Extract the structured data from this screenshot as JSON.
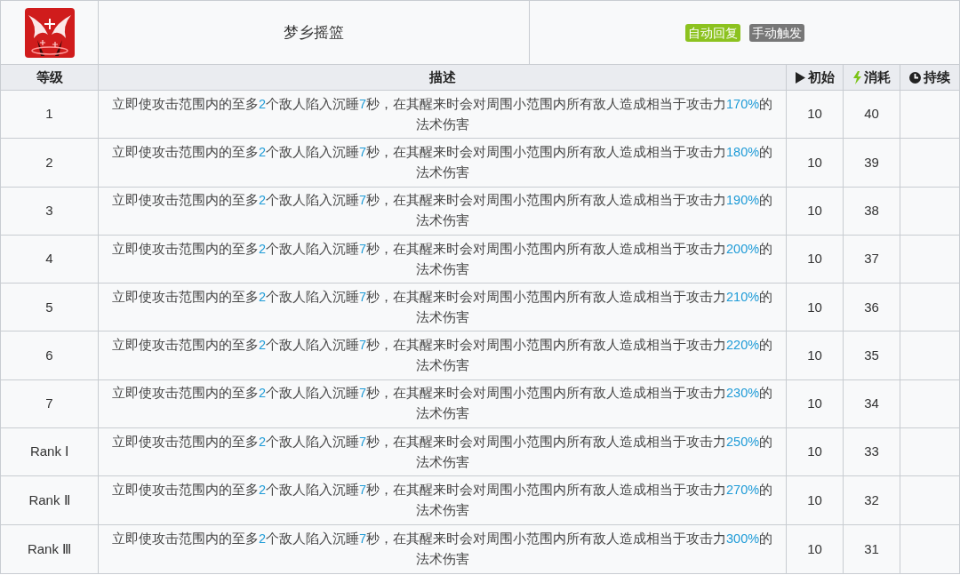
{
  "skill": {
    "name": "梦乡摇篮",
    "tags": [
      {
        "label": "自动回复",
        "color": "#8cc21f"
      },
      {
        "label": "手动触发",
        "color": "#777777"
      }
    ]
  },
  "columns": [
    {
      "label": "等级"
    },
    {
      "label": "描述"
    },
    {
      "label": "初始"
    },
    {
      "label": "消耗"
    },
    {
      "label": "持续"
    }
  ],
  "rows": [
    {
      "level": "1",
      "description": [
        {
          "text": "立即使攻击范围内的至多",
          "highlight": false
        },
        {
          "text": "2",
          "highlight": true
        },
        {
          "text": "个敌人陷入沉睡",
          "highlight": false
        },
        {
          "text": "7",
          "highlight": true
        },
        {
          "text": "秒，在其醒来时会对周围小范围内所有敌人造成相当于攻击力",
          "highlight": false
        },
        {
          "text": "170%",
          "highlight": true
        },
        {
          "text": "的法术伤害",
          "highlight": false
        }
      ],
      "initial": "10",
      "cost": "40"
    },
    {
      "level": "2",
      "description": [
        {
          "text": "立即使攻击范围内的至多",
          "highlight": false
        },
        {
          "text": "2",
          "highlight": true
        },
        {
          "text": "个敌人陷入沉睡",
          "highlight": false
        },
        {
          "text": "7",
          "highlight": true
        },
        {
          "text": "秒，在其醒来时会对周围小范围内所有敌人造成相当于攻击力",
          "highlight": false
        },
        {
          "text": "180%",
          "highlight": true
        },
        {
          "text": "的法术伤害",
          "highlight": false
        }
      ],
      "initial": "10",
      "cost": "39"
    },
    {
      "level": "3",
      "description": [
        {
          "text": "立即使攻击范围内的至多",
          "highlight": false
        },
        {
          "text": "2",
          "highlight": true
        },
        {
          "text": "个敌人陷入沉睡",
          "highlight": false
        },
        {
          "text": "7",
          "highlight": true
        },
        {
          "text": "秒，在其醒来时会对周围小范围内所有敌人造成相当于攻击力",
          "highlight": false
        },
        {
          "text": "190%",
          "highlight": true
        },
        {
          "text": "的法术伤害",
          "highlight": false
        }
      ],
      "initial": "10",
      "cost": "38"
    },
    {
      "level": "4",
      "description": [
        {
          "text": "立即使攻击范围内的至多",
          "highlight": false
        },
        {
          "text": "2",
          "highlight": true
        },
        {
          "text": "个敌人陷入沉睡",
          "highlight": false
        },
        {
          "text": "7",
          "highlight": true
        },
        {
          "text": "秒，在其醒来时会对周围小范围内所有敌人造成相当于攻击力",
          "highlight": false
        },
        {
          "text": "200%",
          "highlight": true
        },
        {
          "text": "的法术伤害",
          "highlight": false
        }
      ],
      "initial": "10",
      "cost": "37"
    },
    {
      "level": "5",
      "description": [
        {
          "text": "立即使攻击范围内的至多",
          "highlight": false
        },
        {
          "text": "2",
          "highlight": true
        },
        {
          "text": "个敌人陷入沉睡",
          "highlight": false
        },
        {
          "text": "7",
          "highlight": true
        },
        {
          "text": "秒，在其醒来时会对周围小范围内所有敌人造成相当于攻击力",
          "highlight": false
        },
        {
          "text": "210%",
          "highlight": true
        },
        {
          "text": "的法术伤害",
          "highlight": false
        }
      ],
      "initial": "10",
      "cost": "36"
    },
    {
      "level": "6",
      "description": [
        {
          "text": "立即使攻击范围内的至多",
          "highlight": false
        },
        {
          "text": "2",
          "highlight": true
        },
        {
          "text": "个敌人陷入沉睡",
          "highlight": false
        },
        {
          "text": "7",
          "highlight": true
        },
        {
          "text": "秒，在其醒来时会对周围小范围内所有敌人造成相当于攻击力",
          "highlight": false
        },
        {
          "text": "220%",
          "highlight": true
        },
        {
          "text": "的法术伤害",
          "highlight": false
        }
      ],
      "initial": "10",
      "cost": "35"
    },
    {
      "level": "7",
      "description": [
        {
          "text": "立即使攻击范围内的至多",
          "highlight": false
        },
        {
          "text": "2",
          "highlight": true
        },
        {
          "text": "个敌人陷入沉睡",
          "highlight": false
        },
        {
          "text": "7",
          "highlight": true
        },
        {
          "text": "秒，在其醒来时会对周围小范围内所有敌人造成相当于攻击力",
          "highlight": false
        },
        {
          "text": "230%",
          "highlight": true
        },
        {
          "text": "的法术伤害",
          "highlight": false
        }
      ],
      "initial": "10",
      "cost": "34"
    },
    {
      "level": "Rank Ⅰ",
      "description": [
        {
          "text": "立即使攻击范围内的至多",
          "highlight": false
        },
        {
          "text": "2",
          "highlight": true
        },
        {
          "text": "个敌人陷入沉睡",
          "highlight": false
        },
        {
          "text": "7",
          "highlight": true
        },
        {
          "text": "秒，在其醒来时会对周围小范围内所有敌人造成相当于攻击力",
          "highlight": false
        },
        {
          "text": "250%",
          "highlight": true
        },
        {
          "text": "的法术伤害",
          "highlight": false
        }
      ],
      "initial": "10",
      "cost": "33"
    },
    {
      "level": "Rank Ⅱ",
      "description": [
        {
          "text": "立即使攻击范围内的至多",
          "highlight": false
        },
        {
          "text": "2",
          "highlight": true
        },
        {
          "text": "个敌人陷入沉睡",
          "highlight": false
        },
        {
          "text": "7",
          "highlight": true
        },
        {
          "text": "秒，在其醒来时会对周围小范围内所有敌人造成相当于攻击力",
          "highlight": false
        },
        {
          "text": "270%",
          "highlight": true
        },
        {
          "text": "的法术伤害",
          "highlight": false
        }
      ],
      "initial": "10",
      "cost": "32"
    },
    {
      "level": "Rank Ⅲ",
      "description": [
        {
          "text": "立即使攻击范围内的至多",
          "highlight": false
        },
        {
          "text": "2",
          "highlight": true
        },
        {
          "text": "个敌人陷入沉睡",
          "highlight": false
        },
        {
          "text": "7",
          "highlight": true
        },
        {
          "text": "秒，在其醒来时会对周围小范围内所有敌人造成相当于攻击力",
          "highlight": false
        },
        {
          "text": "300%",
          "highlight": true
        },
        {
          "text": "的法术伤害",
          "highlight": false
        }
      ],
      "initial": "10",
      "cost": "31"
    }
  ]
}
